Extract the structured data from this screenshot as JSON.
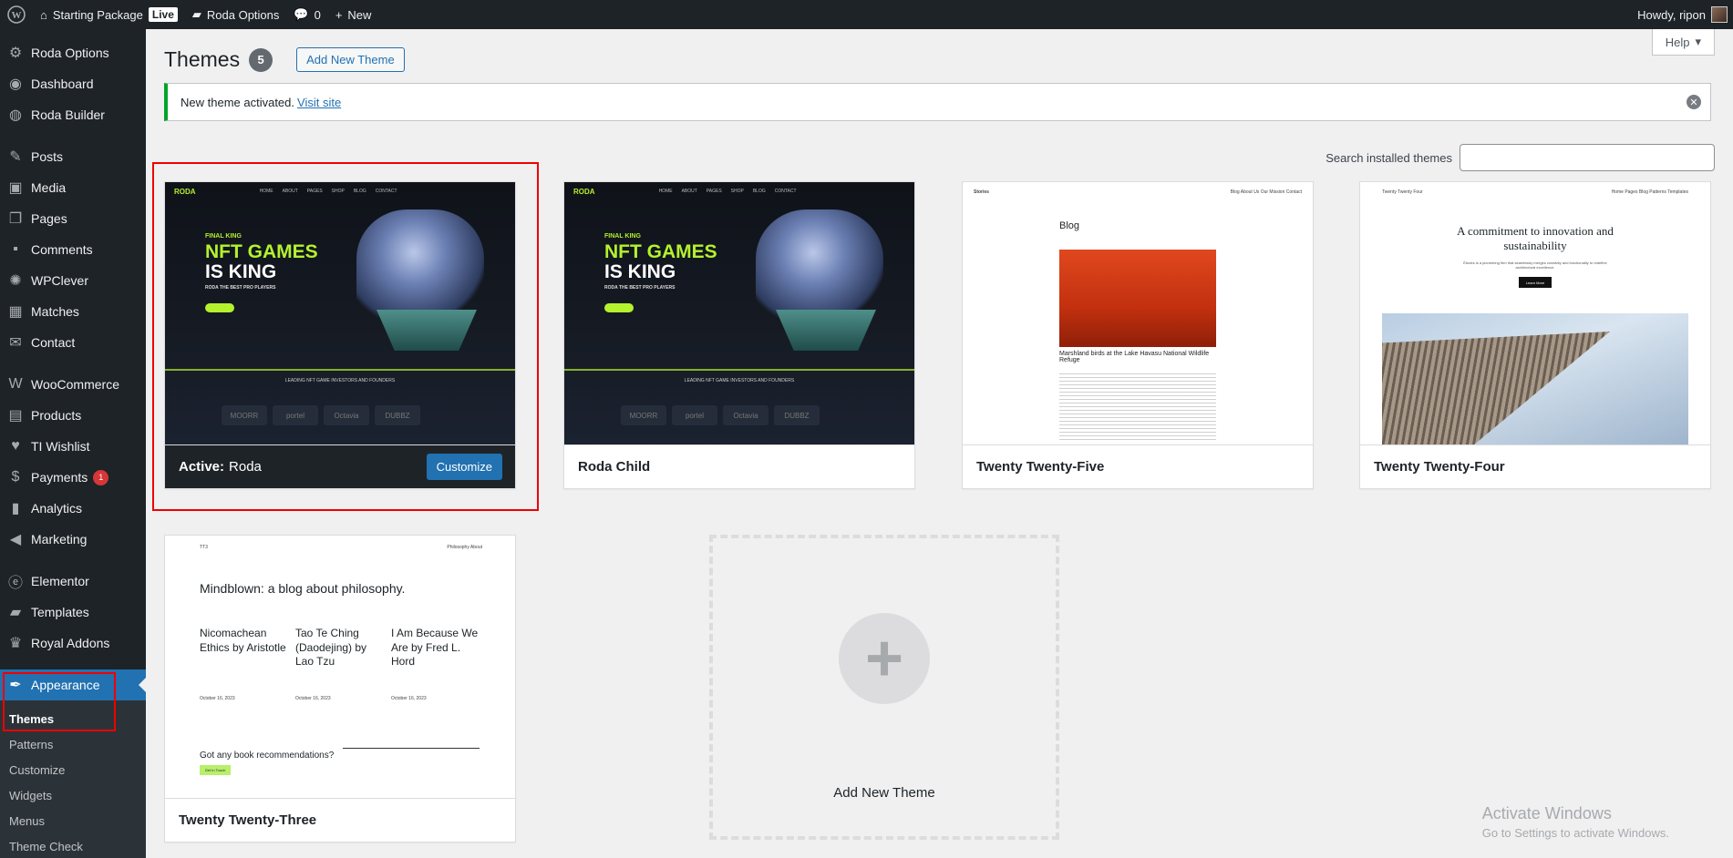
{
  "adminbar": {
    "site_name": "Starting Package",
    "live_label": "Live",
    "roda_options": "Roda Options",
    "comments_count": "0",
    "new_label": "New",
    "howdy": "Howdy, ripon"
  },
  "sidebar": {
    "items": [
      {
        "label": "Roda Options",
        "icon": "gear-icon"
      },
      {
        "label": "Dashboard",
        "icon": "dashboard-icon"
      },
      {
        "label": "Roda Builder",
        "icon": "globe-icon"
      },
      {
        "label": "Posts",
        "icon": "pin-icon"
      },
      {
        "label": "Media",
        "icon": "media-icon"
      },
      {
        "label": "Pages",
        "icon": "pages-icon"
      },
      {
        "label": "Comments",
        "icon": "comment-icon"
      },
      {
        "label": "WPClever",
        "icon": "wpclever-icon"
      },
      {
        "label": "Matches",
        "icon": "calendar-icon"
      },
      {
        "label": "Contact",
        "icon": "mail-icon"
      },
      {
        "label": "WooCommerce",
        "icon": "woocommerce-icon"
      },
      {
        "label": "Products",
        "icon": "products-icon"
      },
      {
        "label": "TI Wishlist",
        "icon": "heart-icon"
      },
      {
        "label": "Payments",
        "icon": "payments-icon",
        "badge": "1"
      },
      {
        "label": "Analytics",
        "icon": "analytics-icon"
      },
      {
        "label": "Marketing",
        "icon": "megaphone-icon"
      },
      {
        "label": "Elementor",
        "icon": "elementor-icon"
      },
      {
        "label": "Templates",
        "icon": "folder-icon"
      },
      {
        "label": "Royal Addons",
        "icon": "crown-icon"
      },
      {
        "label": "Appearance",
        "icon": "brush-icon"
      }
    ],
    "submenu": [
      "Themes",
      "Patterns",
      "Customize",
      "Widgets",
      "Menus",
      "Theme Check"
    ]
  },
  "main": {
    "help_label": "Help",
    "title": "Themes",
    "count": "5",
    "add_new_label": "Add New Theme",
    "notice_text": "New theme activated.",
    "notice_link": "Visit site",
    "search_label": "Search installed themes",
    "search_value": ""
  },
  "themes": {
    "active_prefix": "Active:",
    "active_name": "Roda",
    "customize_label": "Customize",
    "roda_child": "Roda Child",
    "tt5": "Twenty Twenty-Five",
    "tt4": "Twenty Twenty-Four",
    "tt3": "Twenty Twenty-Three",
    "add_new": "Add New Theme"
  },
  "nft_preview": {
    "logo": "RODA",
    "nav": [
      "HOME",
      "ABOUT",
      "PAGES",
      "SHOP",
      "BLOG",
      "CONTACT"
    ],
    "small": "FINAL KING",
    "line1": "NFT GAMES",
    "line2": "IS KING",
    "sub": "RODA THE BEST PRO PLAYERS",
    "partners": "LEADING NFT GAME INVESTORS AND FOUNDERS",
    "logos": [
      "MOORR",
      "portel",
      "Octavia",
      "DUBBZ"
    ]
  },
  "tt5_preview": {
    "site": "Stories",
    "nav": "Blog  About Us  Our Mission  Contact",
    "heading": "Blog",
    "caption": "Marshland birds at the Lake Havasu National Wildlife Refuge"
  },
  "tt4_preview": {
    "site": "Twenty Twenty Four",
    "nav": "Home  Pages  Blog  Patterns  Templates",
    "heading": "A commitment to innovation and sustainability",
    "sub": "Études is a pioneering firm that seamlessly merges creativity and functionality to redefine architectural excellence.",
    "button": "Learn More"
  },
  "tt3_preview": {
    "site": "TT3",
    "nav": "Philosophy  About",
    "heading": "Mindblown: a blog about philosophy.",
    "posts": [
      {
        "title": "Nicomachean Ethics by Aristotle",
        "date": "October 16, 2023"
      },
      {
        "title": "Tao Te Ching (Daodejing) by Lao Tzu",
        "date": "October 16, 2023"
      },
      {
        "title": "I Am Because We Are by Fred L. Hord",
        "date": "October 16, 2023"
      }
    ],
    "cta": "Got any book recommendations?",
    "button": "Get In Touch"
  },
  "watermark": {
    "line1": "Activate Windows",
    "line2": "Go to Settings to activate Windows."
  },
  "colors": {
    "accent": "#2271b1",
    "adminbar": "#1d2327",
    "success": "#00a32a",
    "nft_green": "#b4f22e",
    "highlight": "#e00000"
  }
}
